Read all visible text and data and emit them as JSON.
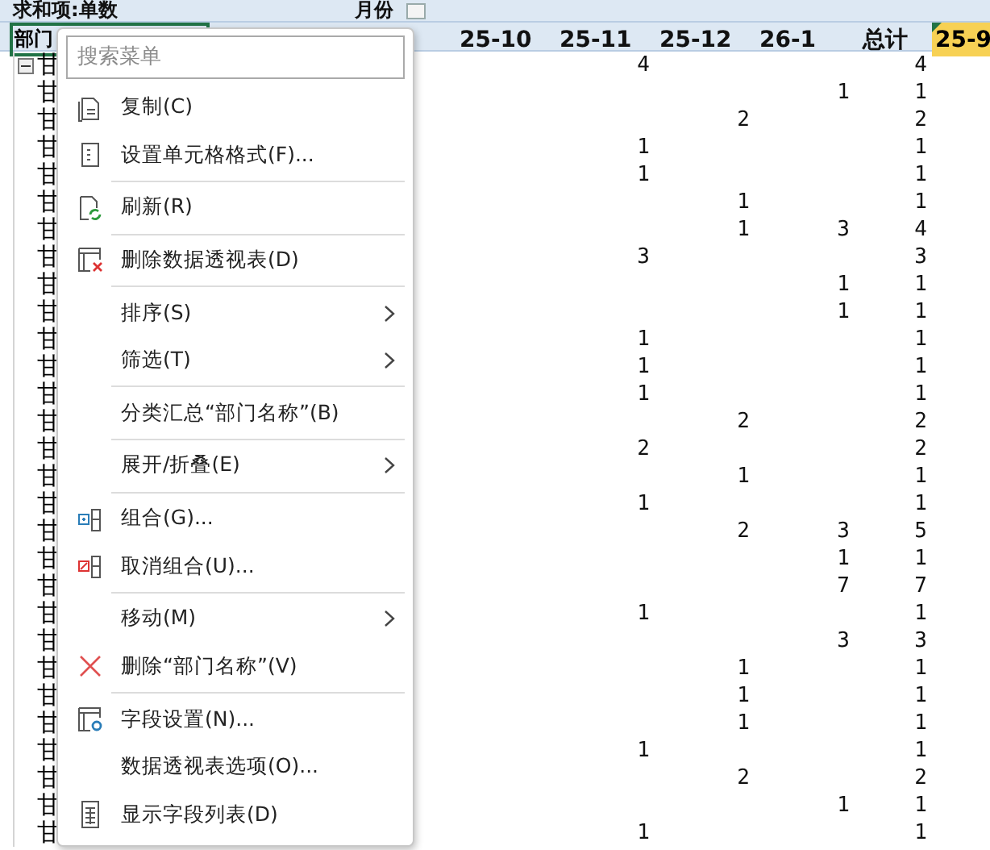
{
  "sheet": {
    "header_top": {
      "field": "求和项:单数",
      "column_field": "月份"
    },
    "header_columns": {
      "row_field": "部门",
      "months": [
        "25-10",
        "25-11",
        "25-12",
        "26-1"
      ],
      "total": "总计",
      "extra": "25-9"
    },
    "rows": [
      {
        "label": "甘",
        "kind": "group",
        "expanded": true,
        "cells": [
          null,
          "4",
          null,
          null,
          "4"
        ]
      },
      {
        "label": "甘",
        "kind": "item",
        "cells": [
          null,
          null,
          null,
          "1",
          "1"
        ]
      },
      {
        "label": "甘",
        "kind": "item",
        "cells": [
          null,
          null,
          "2",
          null,
          "2"
        ]
      },
      {
        "label": "甘",
        "kind": "item",
        "cells": [
          null,
          "1",
          null,
          null,
          "1"
        ]
      },
      {
        "label": "甘",
        "kind": "item",
        "cells": [
          null,
          "1",
          null,
          null,
          "1"
        ]
      },
      {
        "label": "甘",
        "kind": "item",
        "cells": [
          null,
          null,
          "1",
          null,
          "1"
        ]
      },
      {
        "label": "甘",
        "kind": "item",
        "cells": [
          null,
          null,
          "1",
          "3",
          "4"
        ]
      },
      {
        "label": "甘",
        "kind": "item",
        "cells": [
          null,
          "3",
          null,
          null,
          "3"
        ]
      },
      {
        "label": "甘",
        "kind": "item",
        "cells": [
          null,
          null,
          null,
          "1",
          "1"
        ]
      },
      {
        "label": "甘",
        "kind": "item",
        "cells": [
          null,
          null,
          null,
          "1",
          "1"
        ]
      },
      {
        "label": "甘",
        "kind": "item",
        "cells": [
          null,
          "1",
          null,
          null,
          "1"
        ]
      },
      {
        "label": "甘",
        "kind": "item",
        "cells": [
          null,
          "1",
          null,
          null,
          "1"
        ]
      },
      {
        "label": "甘",
        "kind": "item",
        "cells": [
          null,
          "1",
          null,
          null,
          "1"
        ]
      },
      {
        "label": "甘",
        "kind": "item",
        "cells": [
          null,
          null,
          "2",
          null,
          "2"
        ]
      },
      {
        "label": "甘",
        "kind": "item",
        "cells": [
          null,
          "2",
          null,
          null,
          "2"
        ]
      },
      {
        "label": "甘",
        "kind": "item",
        "cells": [
          null,
          null,
          "1",
          null,
          "1"
        ]
      },
      {
        "label": "甘",
        "kind": "item",
        "cells": [
          null,
          "1",
          null,
          null,
          "1"
        ]
      },
      {
        "label": "甘",
        "kind": "item",
        "cells": [
          null,
          null,
          "2",
          "3",
          "5"
        ]
      },
      {
        "label": "甘",
        "kind": "item",
        "cells": [
          null,
          null,
          null,
          "1",
          "1"
        ]
      },
      {
        "label": "甘",
        "kind": "item",
        "cells": [
          null,
          null,
          null,
          "7",
          "7"
        ]
      },
      {
        "label": "甘",
        "kind": "item",
        "cells": [
          null,
          "1",
          null,
          null,
          "1"
        ]
      },
      {
        "label": "甘",
        "kind": "item",
        "cells": [
          null,
          null,
          null,
          "3",
          "3"
        ]
      },
      {
        "label": "甘",
        "kind": "item",
        "cells": [
          null,
          null,
          "1",
          null,
          "1"
        ]
      },
      {
        "label": "甘",
        "kind": "item",
        "cells": [
          null,
          null,
          "1",
          null,
          "1"
        ]
      },
      {
        "label": "甘",
        "kind": "item",
        "cells": [
          null,
          null,
          "1",
          null,
          "1"
        ]
      },
      {
        "label": "甘",
        "kind": "item",
        "cells": [
          null,
          "1",
          null,
          null,
          "1"
        ]
      },
      {
        "label": "甘",
        "kind": "item",
        "cells": [
          null,
          null,
          "2",
          null,
          "2"
        ]
      },
      {
        "label": "甘",
        "kind": "item",
        "cells": [
          null,
          null,
          null,
          "1",
          "1"
        ]
      },
      {
        "label": "甘",
        "kind": "item",
        "cells": [
          null,
          "1",
          null,
          null,
          "1"
        ]
      }
    ]
  },
  "context_menu": {
    "search": {
      "placeholder": "搜索菜单"
    },
    "items": [
      {
        "label": "复制(C)",
        "kind": "copy",
        "submenu": false,
        "separator_after": false
      },
      {
        "label": "设置单元格格式(F)...",
        "kind": "format",
        "submenu": false,
        "separator_after": true
      },
      {
        "label": "刷新(R)",
        "kind": "refresh",
        "submenu": false,
        "separator_after": true
      },
      {
        "label": "删除数据透视表(D)",
        "kind": "delete-table",
        "submenu": false,
        "separator_after": true
      },
      {
        "label": "排序(S)",
        "kind": "plain",
        "submenu": true,
        "separator_after": false
      },
      {
        "label": "筛选(T)",
        "kind": "plain",
        "submenu": true,
        "separator_after": true
      },
      {
        "label": "分类汇总“部门名称”(B)",
        "kind": "plain",
        "submenu": false,
        "separator_after": true
      },
      {
        "label": "展开/折叠(E)",
        "kind": "plain",
        "submenu": true,
        "separator_after": true
      },
      {
        "label": "组合(G)...",
        "kind": "group",
        "submenu": false,
        "separator_after": false
      },
      {
        "label": "取消组合(U)...",
        "kind": "ungroup",
        "submenu": false,
        "separator_after": true
      },
      {
        "label": "移动(M)",
        "kind": "plain",
        "submenu": true,
        "separator_after": false
      },
      {
        "label": "删除“部门名称”(V)",
        "kind": "remove",
        "submenu": false,
        "separator_after": true
      },
      {
        "label": "字段设置(N)...",
        "kind": "field-settings",
        "submenu": false,
        "separator_after": false
      },
      {
        "label": "数据透视表选项(O)...",
        "kind": "plain",
        "submenu": false,
        "separator_after": false
      },
      {
        "label": "显示字段列表(D)",
        "kind": "field-list",
        "submenu": false,
        "separator_after": false
      }
    ]
  }
}
